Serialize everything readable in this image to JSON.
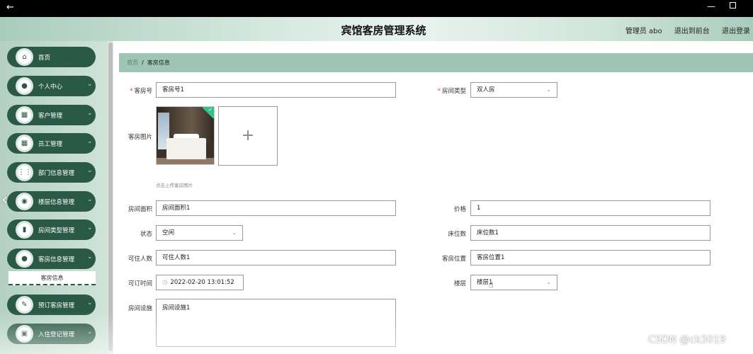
{
  "window": {
    "back_glyph": "←",
    "min_glyph": "—"
  },
  "header": {
    "title": "宾馆客房管理系统",
    "admin": "管理员 abo",
    "to_front": "退出到前台",
    "logout": "退出登录"
  },
  "sidebar": {
    "items": [
      {
        "label": "首页",
        "icon": "home-icon",
        "glyph": "⌂",
        "chevron": ""
      },
      {
        "label": "个人中心",
        "icon": "user-icon",
        "glyph": "●",
        "chevron": "⌄"
      },
      {
        "label": "客户管理",
        "icon": "grid-icon",
        "glyph": "▦",
        "chevron": "⌄"
      },
      {
        "label": "员工管理",
        "icon": "grid-icon",
        "glyph": "▦",
        "chevron": "⌄"
      },
      {
        "label": "部门信息管理",
        "icon": "apps-icon",
        "glyph": "⋮⋮",
        "chevron": "⌄"
      },
      {
        "label": "楼层信息管理",
        "icon": "location-icon",
        "glyph": "◉",
        "chevron": "⌄"
      },
      {
        "label": "房间类型管理",
        "icon": "chart-icon",
        "glyph": "▮",
        "chevron": "⌄"
      },
      {
        "label": "客房信息管理",
        "icon": "person-icon",
        "glyph": "●",
        "chevron": "⌄"
      },
      {
        "label": "预订客房管理",
        "icon": "edit-icon",
        "glyph": "✎",
        "chevron": "⌄"
      },
      {
        "label": "入住登记管理",
        "icon": "bag-icon",
        "glyph": "▣",
        "chevron": "⌄"
      }
    ],
    "sub_item": "客房信息",
    "collapse_glyph": "‹"
  },
  "breadcrumb": {
    "home": "首页",
    "sep": "/",
    "current": "客房信息"
  },
  "form": {
    "room_no": {
      "label": "客房号",
      "value": "客房号1"
    },
    "room_type": {
      "label": "房间类型",
      "value": "双人房"
    },
    "room_image": {
      "label": "客房图片",
      "hint": "点击上传客房图片",
      "plus": "+"
    },
    "area": {
      "label": "房间面积",
      "value": "房间面积1"
    },
    "price": {
      "label": "价格",
      "value": "1"
    },
    "status": {
      "label": "状态",
      "value": "空闲"
    },
    "beds": {
      "label": "床位数",
      "value": "床位数1"
    },
    "capacity": {
      "label": "可住人数",
      "value": "可住人数1"
    },
    "location": {
      "label": "客房位置",
      "value": "客房位置1"
    },
    "available_time": {
      "label": "可订时间",
      "value": "2022-02-20 13:01:52",
      "clock": "◷"
    },
    "floor": {
      "label": "楼层",
      "value": "楼层1"
    },
    "facilities": {
      "label": "房间设施",
      "value": "房间设施1"
    },
    "select_arrow": "⌄",
    "required_mark": "*"
  },
  "watermark": "CSDN @ck3019",
  "cursor_glyph": "☝"
}
